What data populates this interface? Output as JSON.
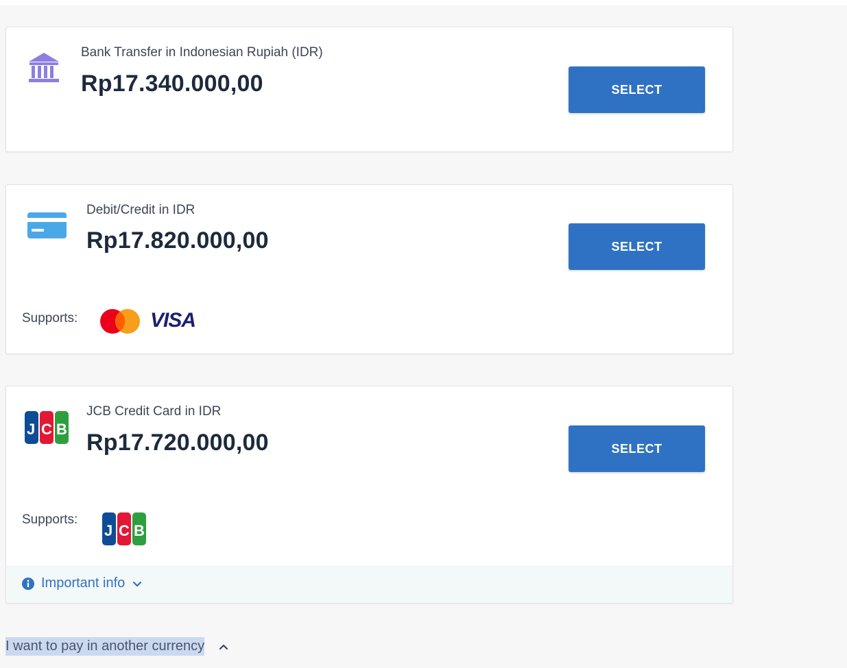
{
  "payment_options": [
    {
      "label": "Bank Transfer in Indonesian Rupiah (IDR)",
      "price": "Rp17.340.000,00",
      "icon": "bank-icon",
      "button": "SELECT"
    },
    {
      "label": "Debit/Credit in IDR",
      "price": "Rp17.820.000,00",
      "icon": "credit-card-icon",
      "button": "SELECT",
      "supports_label": "Supports:",
      "supports_logos": [
        "mastercard-logo",
        "visa-logo"
      ],
      "visa_text": "VISA"
    },
    {
      "label": "JCB Credit Card in IDR",
      "price": "Rp17.720.000,00",
      "icon": "jcb-icon",
      "button": "SELECT",
      "supports_label": "Supports:",
      "supports_logos": [
        "jcb-logo"
      ],
      "info_label": "Important info"
    }
  ],
  "other_currency": {
    "label": "I want to pay in another currency"
  },
  "colors": {
    "primary": "#2f72c4",
    "bank_icon": "#8b7fe0",
    "card_icon": "#4aa8e8",
    "mastercard_red": "#eb001b",
    "mastercard_orange": "#f79e1b",
    "visa_blue": "#1a1f71"
  }
}
